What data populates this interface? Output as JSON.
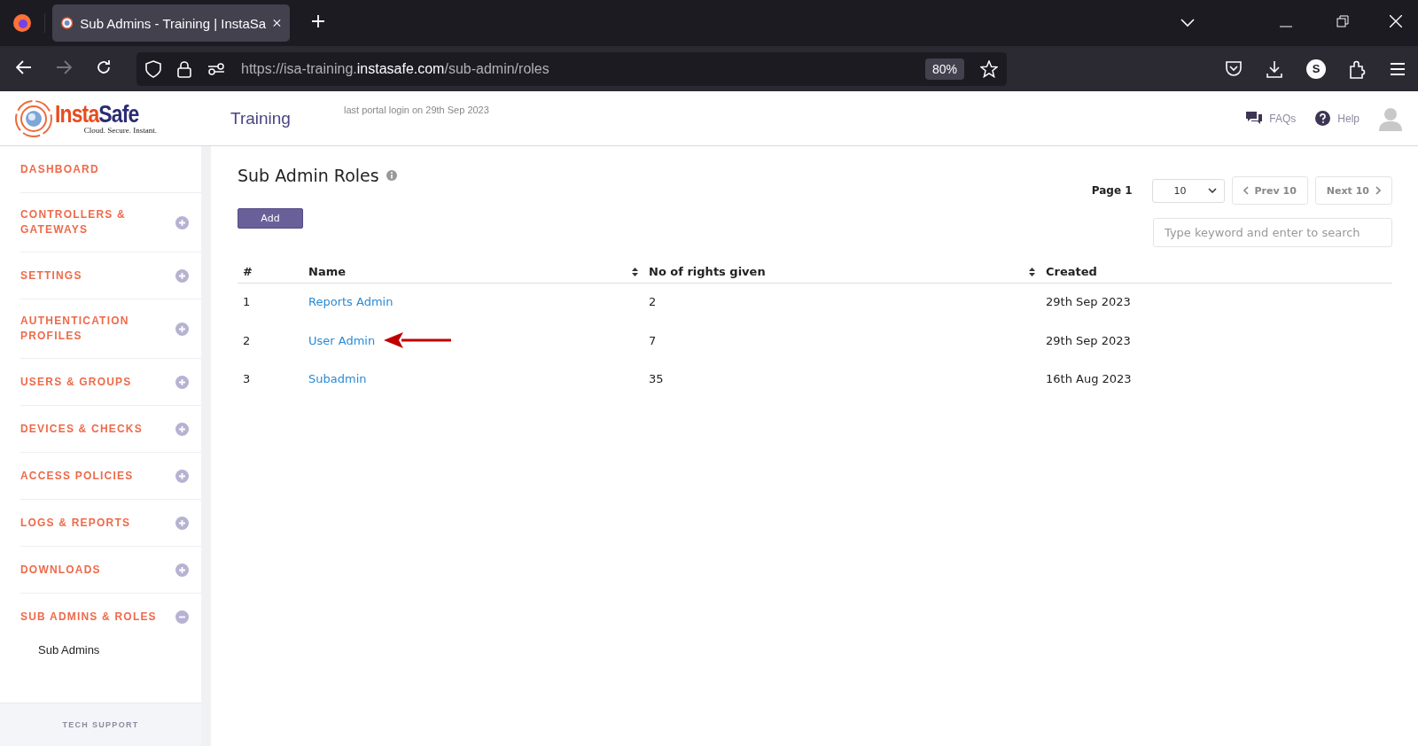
{
  "browser": {
    "tab_title": "Sub Admins - Training | InstaSa",
    "url_prefix": "https://isa-training.",
    "url_domain": "instasafe.com",
    "url_path": "/sub-admin/roles",
    "zoom": "80%",
    "profile_initial": "S"
  },
  "header": {
    "logo_parts": [
      "Insta",
      "Safe"
    ],
    "logo_tagline": "Cloud. Secure. Instant.",
    "portal_name": "Training",
    "last_login": "last portal login on 29th Sep 2023",
    "faqs": "FAQs",
    "help": "Help"
  },
  "sidebar": {
    "items": [
      {
        "label": "DASHBOARD",
        "kind": "link"
      },
      {
        "label": "CONTROLLERS & GATEWAYS",
        "kind": "group",
        "expanded": false
      },
      {
        "label": "SETTINGS",
        "kind": "group",
        "expanded": false
      },
      {
        "label": "AUTHENTICATION PROFILES",
        "kind": "group",
        "expanded": false
      },
      {
        "label": "USERS & GROUPS",
        "kind": "group",
        "expanded": false
      },
      {
        "label": "DEVICES & CHECKS",
        "kind": "group",
        "expanded": false
      },
      {
        "label": "ACCESS POLICIES",
        "kind": "group",
        "expanded": false
      },
      {
        "label": "LOGS & REPORTS",
        "kind": "group",
        "expanded": false
      },
      {
        "label": "DOWNLOADS",
        "kind": "group",
        "expanded": false
      },
      {
        "label": "SUB ADMINS & ROLES",
        "kind": "group",
        "expanded": true,
        "children": [
          {
            "label": "Sub Admins"
          }
        ]
      }
    ],
    "footer": "TECH SUPPORT"
  },
  "page": {
    "title": "Sub Admin Roles",
    "add_button": "Add",
    "page_label": "Page 1",
    "per_page": "10",
    "prev": "Prev 10",
    "next": "Next 10",
    "search": {
      "placeholder": "Type keyword and enter to search"
    }
  },
  "table": {
    "columns": [
      {
        "label": "#",
        "sortable": false
      },
      {
        "label": "Name",
        "sortable": true
      },
      {
        "label": "No of rights given",
        "sortable": true
      },
      {
        "label": "Created",
        "sortable": false
      }
    ],
    "rows": [
      {
        "number": "1",
        "name": "Reports Admin",
        "rights": "2",
        "created": "29th Sep 2023",
        "annotated": false
      },
      {
        "number": "2",
        "name": "User Admin",
        "rights": "7",
        "created": "29th Sep 2023",
        "annotated": true
      },
      {
        "number": "3",
        "name": "Subadmin",
        "rights": "35",
        "created": "16th Aug 2023",
        "annotated": false
      }
    ]
  }
}
